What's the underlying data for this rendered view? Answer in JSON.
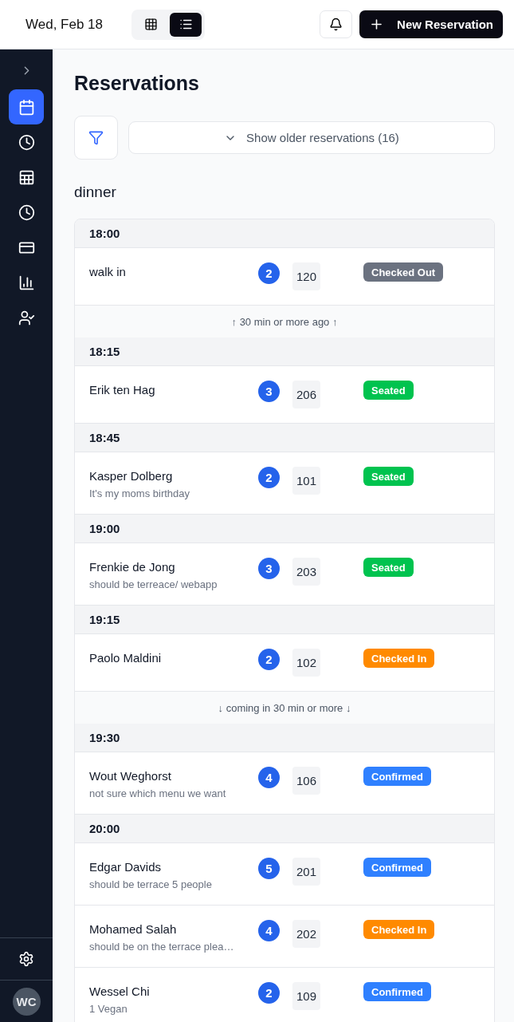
{
  "header": {
    "date": "Wed, Feb 18",
    "views": [
      {
        "kind": "grid",
        "selected": false
      },
      {
        "kind": "list",
        "selected": true
      }
    ],
    "new_button": "New Reservation"
  },
  "sidebar": {
    "items": [
      {
        "kind": "calendar",
        "selected": true
      },
      {
        "kind": "clock",
        "selected": false
      },
      {
        "kind": "table",
        "selected": false
      },
      {
        "kind": "clock",
        "selected": false
      },
      {
        "kind": "card",
        "selected": false
      },
      {
        "kind": "chart",
        "selected": false
      },
      {
        "kind": "user-check",
        "selected": false
      }
    ],
    "avatar": "WC"
  },
  "title": "Reservations",
  "older_button": "Show older reservations (16)",
  "section": "dinner",
  "entries": [
    {
      "kind": "time",
      "text": "18:00"
    },
    {
      "kind": "reservation",
      "name": "walk in",
      "party": "2",
      "table": "120",
      "status": "Checked Out",
      "color": "#6b7280"
    },
    {
      "kind": "divider",
      "text": "↑ 30 min or more ago ↑"
    },
    {
      "kind": "time",
      "text": "18:15"
    },
    {
      "kind": "reservation",
      "name": "Erik ten Hag",
      "party": "3",
      "table": "206",
      "status": "Seated",
      "color": "#00c34f"
    },
    {
      "kind": "time",
      "text": "18:45"
    },
    {
      "kind": "reservation",
      "name": "Kasper Dolberg",
      "note": "It's my moms birthday",
      "party": "2",
      "table": "101",
      "status": "Seated",
      "color": "#00c34f"
    },
    {
      "kind": "time",
      "text": "19:00"
    },
    {
      "kind": "reservation",
      "name": "Frenkie de Jong",
      "note": "should be terreace/ webapp",
      "party": "3",
      "table": "203",
      "status": "Seated",
      "color": "#00c34f"
    },
    {
      "kind": "time",
      "text": "19:15"
    },
    {
      "kind": "reservation",
      "name": "Paolo Maldini",
      "party": "2",
      "table": "102",
      "status": "Checked In",
      "color": "#ff8a00"
    },
    {
      "kind": "divider",
      "text": "↓ coming in 30 min or more ↓"
    },
    {
      "kind": "time",
      "text": "19:30"
    },
    {
      "kind": "reservation",
      "name": "Wout Weghorst",
      "note": "not sure which menu we want",
      "party": "4",
      "table": "106",
      "status": "Confirmed",
      "color": "#2f80ff"
    },
    {
      "kind": "time",
      "text": "20:00"
    },
    {
      "kind": "reservation",
      "name": "Edgar Davids",
      "note": "should be terrace 5 people",
      "party": "5",
      "table": "201",
      "status": "Confirmed",
      "color": "#2f80ff"
    },
    {
      "kind": "reservation",
      "name": "Mohamed Salah",
      "note": "should be on the terrace plea…",
      "party": "4",
      "table": "202",
      "status": "Checked In",
      "color": "#ff8a00"
    },
    {
      "kind": "reservation",
      "name": "Wessel Chi",
      "note": "1 Vegan",
      "party": "2",
      "table": "109",
      "status": "Confirmed",
      "color": "#2f80ff"
    }
  ]
}
